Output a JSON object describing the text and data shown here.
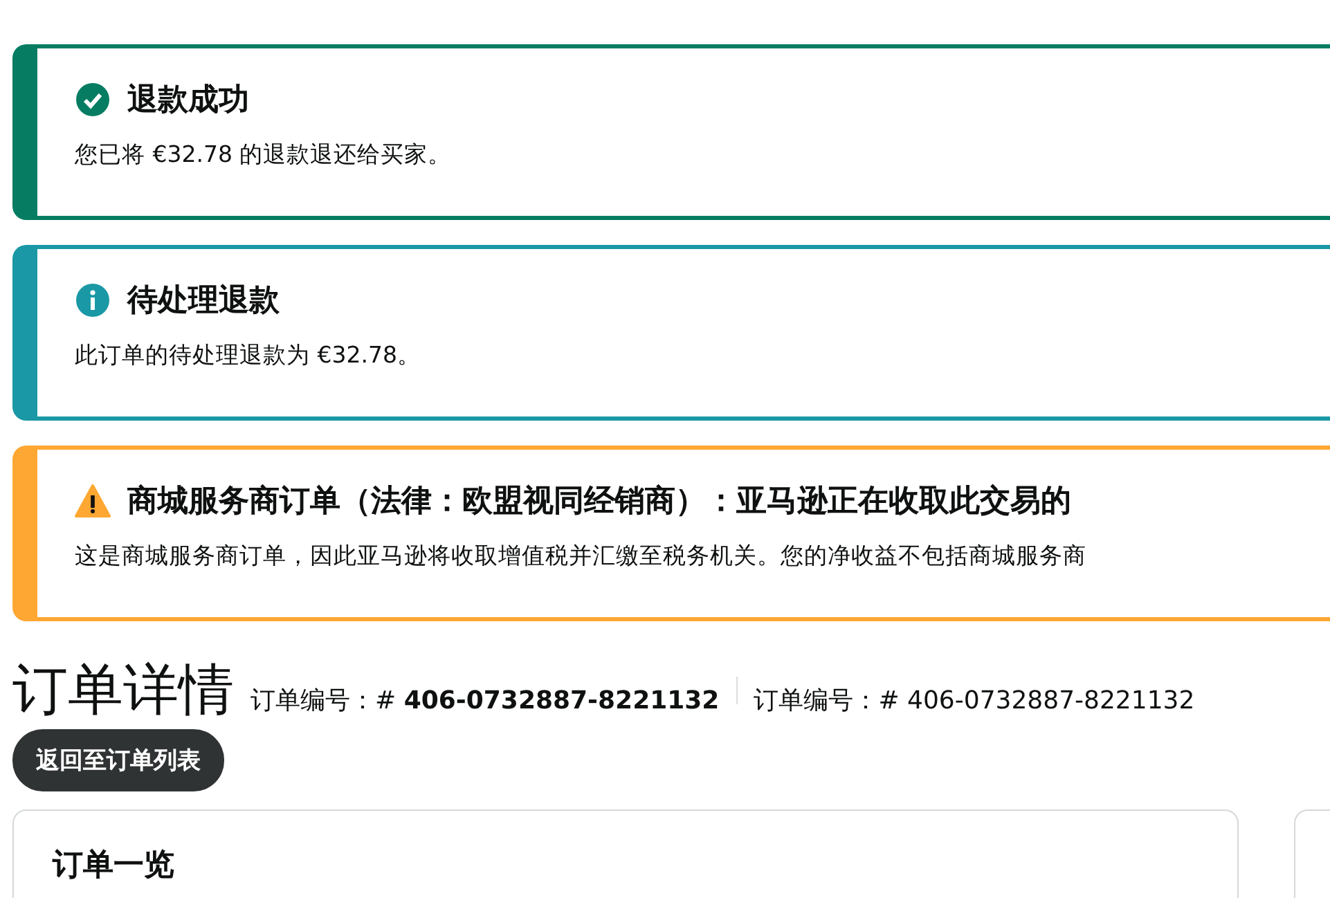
{
  "alerts": [
    {
      "kind": "success",
      "title": "退款成功",
      "body": "您已将 €32.78 的退款退还给买家。"
    },
    {
      "kind": "info",
      "title": "待处理退款",
      "body": "此订单的待处理退款为 €32.78。"
    },
    {
      "kind": "warning",
      "title": "商城服务商订单（法律：欧盟视同经销商）：亚马逊正在收取此交易的",
      "body": "这是商城服务商订单，因此亚马逊将收取增值税并汇缴至税务机关。您的净收益不包括商城服务商"
    }
  ],
  "page_title": "订单详情",
  "order_ids": [
    {
      "label": "订单编号：#",
      "value": "406-0732887-8221132",
      "emphasized": true
    },
    {
      "label": "订单编号：#",
      "value": "406-0732887-8221132",
      "emphasized": false
    }
  ],
  "back_button": "返回至订单列表",
  "summary_card": {
    "title": "订单一览"
  }
}
